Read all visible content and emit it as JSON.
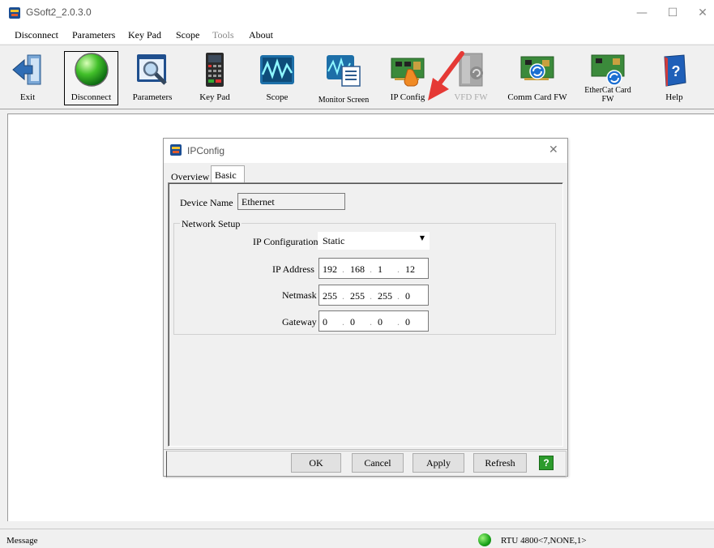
{
  "window": {
    "title": "GSoft2_2.0.3.0",
    "minimize_glyph": "—",
    "maximize_glyph": "☐",
    "close_glyph": "✕"
  },
  "menu": {
    "items": [
      {
        "label": "Disconnect",
        "enabled": true
      },
      {
        "label": "Parameters",
        "enabled": true
      },
      {
        "label": "Key Pad",
        "enabled": true
      },
      {
        "label": "Scope",
        "enabled": true
      },
      {
        "label": "Tools",
        "enabled": false
      },
      {
        "label": "About",
        "enabled": true
      }
    ]
  },
  "toolbar": {
    "items": [
      {
        "label": "Exit",
        "icon": "exit-arrow-icon"
      },
      {
        "label": "Disconnect",
        "icon": "green-led-icon",
        "selected": true
      },
      {
        "label": "Parameters",
        "icon": "magnifier-window-icon"
      },
      {
        "label": "Key Pad",
        "icon": "keypad-icon"
      },
      {
        "label": "Scope",
        "icon": "waveform-icon"
      },
      {
        "label": "Monitor Screen",
        "icon": "monitor-screen-icon"
      },
      {
        "label": "IP Config",
        "icon": "circuit-board-hand-icon"
      },
      {
        "label": "VFD FW",
        "icon": "vfd-refresh-icon",
        "disabled": true
      },
      {
        "label": "Comm Card FW",
        "icon": "comm-card-refresh-icon"
      },
      {
        "label": "EtherCat Card\nFW",
        "icon": "ethercat-card-refresh-icon"
      },
      {
        "label": "Help",
        "icon": "help-book-icon"
      }
    ]
  },
  "dialog": {
    "title": "IPConfig",
    "close_glyph": "✕",
    "tabs": [
      {
        "label": "Overview",
        "active": false
      },
      {
        "label": "Basic",
        "active": true
      }
    ],
    "device_name_label": "Device Name",
    "device_name_value": "Ethernet",
    "group_label": "Network Setup",
    "ip_configuration_label": "IP Configuration",
    "ip_configuration_value": "Static",
    "ip_address_label": "IP Address",
    "ip_address": [
      "192",
      "168",
      "1",
      "12"
    ],
    "netmask_label": "Netmask",
    "netmask": [
      "255",
      "255",
      "255",
      "0"
    ],
    "gateway_label": "Gateway",
    "gateway": [
      "0",
      "0",
      "0",
      "0"
    ],
    "buttons": {
      "ok": "OK",
      "cancel": "Cancel",
      "apply": "Apply",
      "refresh": "Refresh",
      "help": "?"
    }
  },
  "status": {
    "message_label": "Message",
    "connection": "RTU 4800<7,NONE,1>"
  },
  "colors": {
    "annotation_arrow": "#e53935",
    "status_led": "#1aa21a",
    "help_button": "#2c9b2c"
  }
}
